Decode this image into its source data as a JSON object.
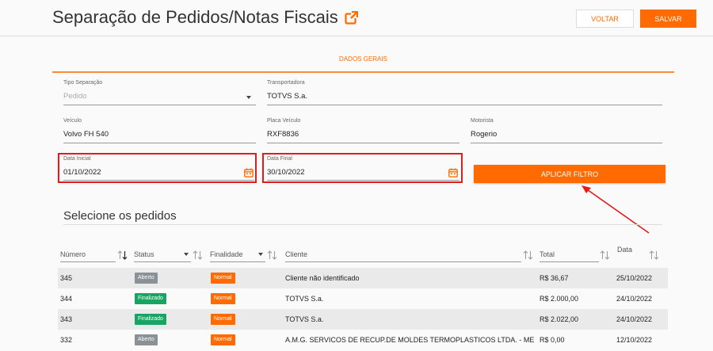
{
  "header": {
    "title": "Separação de Pedidos/Notas Fiscais",
    "voltar_label": "VOLTAR",
    "salvar_label": "SALVAR"
  },
  "tab": {
    "label": "DADOS GERAIS"
  },
  "form": {
    "tipo_separacao": {
      "label": "Tipo Separação",
      "placeholder": "Pedido"
    },
    "transportadora": {
      "label": "Transportadora",
      "value": "TOTVS S.a."
    },
    "veiculo": {
      "label": "Veículo",
      "value": "Volvo FH 540"
    },
    "placa_veiculo": {
      "label": "Placa Veículo",
      "value": "RXF8836"
    },
    "motorista": {
      "label": "Motorista",
      "value": "Rogerio"
    },
    "data_inicial": {
      "label": "Data Inicial",
      "value": "01/10/2022"
    },
    "data_final": {
      "label": "Data Final",
      "value": "30/10/2022"
    },
    "aplicar_filtro_label": "APLICAR FILTRO"
  },
  "orders": {
    "title": "Selecione os pedidos",
    "columns": {
      "numero": "Número",
      "status": "Status",
      "finalidade": "Finalidade",
      "cliente": "Cliente",
      "total": "Total",
      "data": "Data"
    },
    "rows": [
      {
        "numero": "345",
        "status": "Aberto",
        "finalidade": "Normal",
        "cliente": "Cliente não identificado",
        "total": "R$ 36,67",
        "data": "25/10/2022"
      },
      {
        "numero": "344",
        "status": "Finalizado",
        "finalidade": "Normal",
        "cliente": "TOTVS S.a.",
        "total": "R$ 2.000,00",
        "data": "24/10/2022"
      },
      {
        "numero": "343",
        "status": "Finalizado",
        "finalidade": "Normal",
        "cliente": "TOTVS S.a.",
        "total": "R$ 2.022,00",
        "data": "24/10/2022"
      },
      {
        "numero": "332",
        "status": "Aberto",
        "finalidade": "Normal",
        "cliente": "A.M.G. SERVICOS DE RECUP.DE MOLDES TERMOPLASTICOS LTDA. - ME",
        "total": "R$ 0,00",
        "data": "12/10/2022"
      }
    ]
  },
  "colors": {
    "accent": "#ff6b00",
    "highlight": "#e41b1b",
    "badge_aberto": "#8a9296",
    "badge_finalizado": "#19a463",
    "badge_normal": "#ff6b00"
  },
  "icons": [
    "external-link-icon",
    "chevron-down-icon",
    "calendar-icon",
    "sort-icon",
    "annotation-arrow"
  ]
}
